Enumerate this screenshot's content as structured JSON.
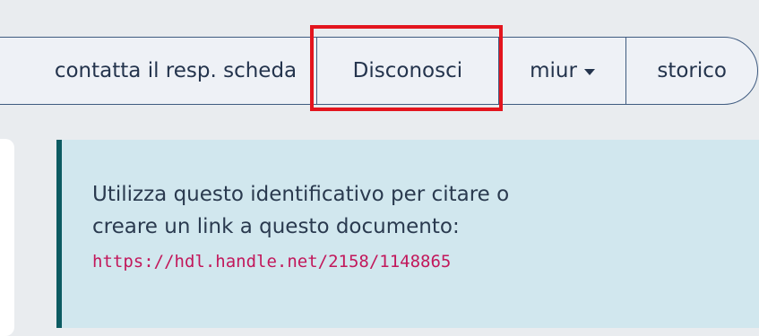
{
  "toolbar": {
    "contact_label": "contatta il resp. scheda",
    "disown_label": "Disconosci",
    "miur_label": "miur",
    "history_label": "storico"
  },
  "info": {
    "line1": "Utilizza questo identificativo per citare o",
    "line2": "creare un link a questo documento:",
    "handle_url": "https://hdl.handle.net/2158/1148865"
  },
  "colors": {
    "highlight": "#e3151e",
    "info_bg": "#d1e7ee",
    "info_border": "#0c5b62",
    "link": "#c2185b"
  },
  "icons": {
    "miur_dropdown": "caret-down-icon"
  }
}
